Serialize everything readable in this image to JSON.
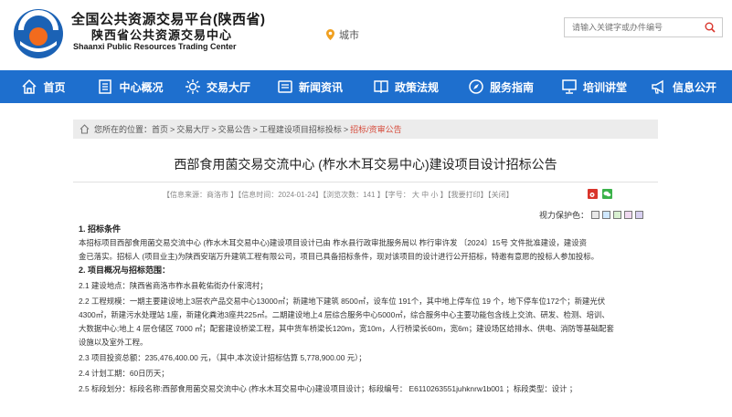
{
  "header": {
    "org_cn_line1": "全国公共资源交易平台(陕西省)",
    "org_cn_line2": "陕西省公共资源交易中心",
    "org_en": "Shaanxi Public Resources Trading Center",
    "location_label": "城市",
    "search_placeholder": "请输入关键字或办件编号"
  },
  "nav": {
    "items": [
      {
        "label": "首页",
        "icon": "home-icon"
      },
      {
        "label": "中心概况",
        "icon": "building-icon"
      },
      {
        "label": "交易大厅",
        "icon": "sun-icon"
      },
      {
        "label": "新闻资讯",
        "icon": "news-icon"
      },
      {
        "label": "政策法规",
        "icon": "book-icon"
      },
      {
        "label": "服务指南",
        "icon": "compass-icon"
      },
      {
        "label": "培训讲堂",
        "icon": "screen-icon"
      },
      {
        "label": "信息公开",
        "icon": "megaphone-icon"
      }
    ]
  },
  "breadcrumb": {
    "prefix": "您所在的位置：",
    "items": [
      "首页",
      "交易大厅",
      "交易公告",
      "工程建设项目招标投标",
      "招标/资审公告"
    ]
  },
  "article": {
    "title": "西部食用菌交易交流中心 (柞水木耳交易中心)建设项目设计招标公告",
    "meta": "【信息来源：商洛市 】【信息时间：2024-01-24】【浏览次数：141 】【字号： 大  中  小 】【我要打印】【关闭】",
    "eye_protect_label": "视力保护色：",
    "eye_colors": [
      "#e8e8e8",
      "#cfe8ff",
      "#d8f0d0",
      "#f0d8f0",
      "#d8d0f0"
    ],
    "s1_heading": "1. 招标条件",
    "s1_line1": "本招标项目西部食用菌交易交流中心 (柞水木耳交易中心)建设项目设计已由   柞水县行政审批服务局以   柞行审许发 〔2024〕15号      文件批准建设，建设资",
    "s1_line2": "金已落实。招标人 (项目业主)为陕西安瑞万升建筑工程有限公司，项目已具备招标条件，现对该项目的设计进行公开招标，特邀有意愿的投标人参加投标。",
    "s2_heading": "2. 项目概况与招标范围：",
    "s2_1": "2.1 建设地点：陕西省商洛市柞水县乾佑街办什家湾村；",
    "s2_2_line1": "2.2 工程规模：一期主要建设地上3层农产品交易中心13000㎡；新建地下建筑 8500㎡，设车位 191个，其中地上停车位 19 个，地下停车位172个；新建光伏",
    "s2_2_line2": "4300㎡，新建污水处理站 1座，新建化粪池3座共225㎡。二期建设地上4 层综合服务中心5000㎡，综合服务中心主要功能包含线上交流、研发、检测、培训、",
    "s2_2_line3": "大数据中心;地上 4 层仓储区 7000 ㎡；配套建设桥梁工程，其中货车桥梁长120m，宽10m，人行桥梁长60m，宽6m；建设场区给排水、供电、消防等基础配套",
    "s2_2_line4": "设施以及室外工程。",
    "s2_3": "2.3 项目投资总额：235,476,400.00 元，（其中,本次设计招标估算   5,778,900.00 元）；",
    "s2_4": "2.4 计划工期：60日历天；",
    "s2_5": "2.5 标段划分：标段名称:西部食用菌交易交流中心 (柞水木耳交易中心)建设项目设计；标段编号：  E6110263551juhknrw1b001     ；标段类型：设计 ；"
  }
}
